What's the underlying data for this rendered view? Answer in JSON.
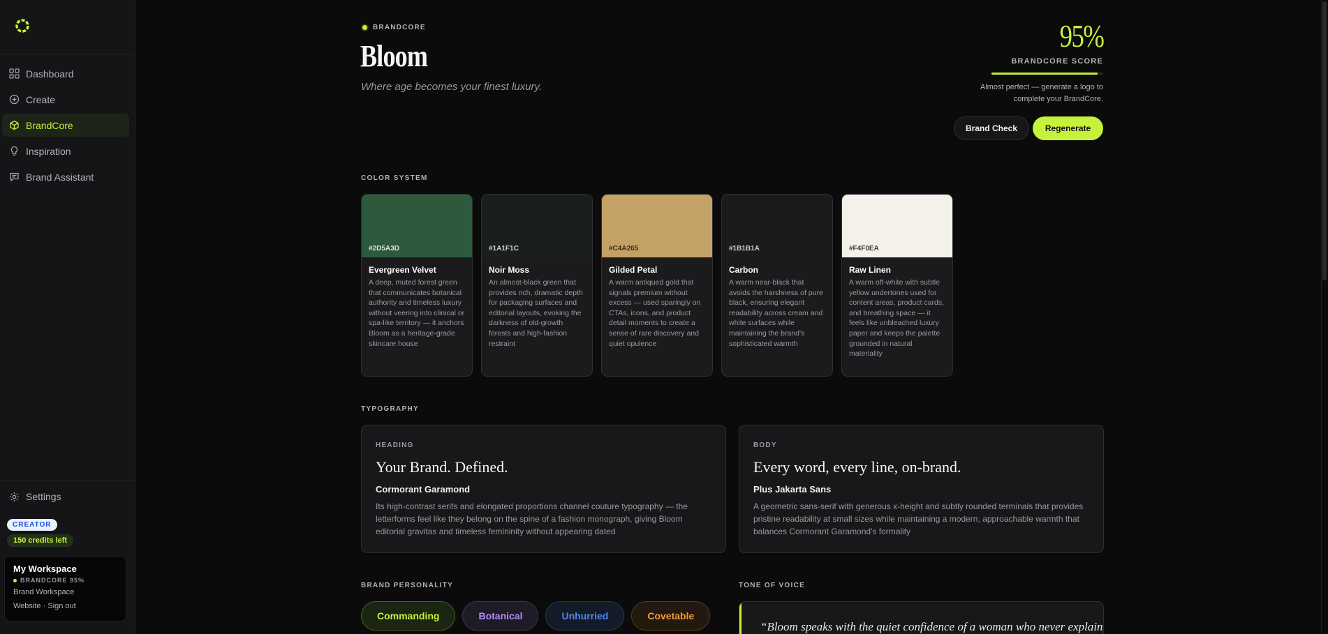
{
  "sidebar": {
    "nav": [
      {
        "label": "Dashboard",
        "icon": "grid-icon"
      },
      {
        "label": "Create",
        "icon": "plus-circle-icon"
      },
      {
        "label": "BrandCore",
        "icon": "cube-icon",
        "active": true
      },
      {
        "label": "Inspiration",
        "icon": "lightbulb-icon"
      },
      {
        "label": "Brand Assistant",
        "icon": "chat-icon"
      }
    ],
    "settings_label": "Settings",
    "plan_badge": "CREATOR",
    "credits": "150 credits left",
    "workspace": {
      "title": "My Workspace",
      "score": "BRANDCORE 95%",
      "type": "Brand Workspace",
      "link_website": "Website",
      "separator": " · ",
      "link_signout": "Sign out"
    }
  },
  "header": {
    "eyebrow": "BRANDCORE",
    "brand_name": "Bloom",
    "tagline": "Where age becomes your finest luxury."
  },
  "score": {
    "value": "95%",
    "fill_fraction": 0.95,
    "label": "BRANDCORE SCORE",
    "note": "Almost perfect — generate a logo to complete your BrandCore.",
    "brand_check_label": "Brand Check",
    "regenerate_label": "Regenerate"
  },
  "color_system": {
    "label": "COLOR SYSTEM",
    "swatches": [
      {
        "hex": "#2D5A3D",
        "name": "Evergreen Velvet",
        "hex_text_color": "#d9e4dc",
        "desc": "A deep, muted forest green that communicates botanical authority and timeless luxury without veering into clinical or spa-like territory — it anchors Bloom as a heritage-grade skincare house"
      },
      {
        "hex": "#1A1F1C",
        "name": "Noir Moss",
        "hex_text_color": "#d0d0d0",
        "desc": "An almost-black green that provides rich, dramatic depth for packaging surfaces and editorial layouts, evoking the darkness of old-growth forests and high-fashion restraint"
      },
      {
        "hex": "#C4A265",
        "name": "Gilded Petal",
        "hex_text_color": "#3a2f18",
        "desc": "A warm antiqued gold that signals premium without excess — used sparingly on CTAs, icons, and product detail moments to create a sense of rare discovery and quiet opulence"
      },
      {
        "hex": "#1B1B1A",
        "name": "Carbon",
        "hex_text_color": "#d0d0d0",
        "desc": "A warm near-black that avoids the harshness of pure black, ensuring elegant readability across cream and white surfaces while maintaining the brand's sophisticated warmth"
      },
      {
        "hex": "#F4F0EA",
        "name": "Raw Linen",
        "hex_text_color": "#3a3a3a",
        "desc": "A warm off-white with subtle yellow undertones used for content areas, product cards, and breathing space — it feels like unbleached luxury paper and keeps the palette grounded in natural materiality"
      }
    ]
  },
  "typography": {
    "label": "TYPOGRAPHY",
    "heading": {
      "kind": "HEADING",
      "sample": "Your Brand. Defined.",
      "font": "Cormorant Garamond",
      "desc": "Its high-contrast serifs and elongated proportions channel couture typography — the letterforms feel like they belong on the spine of a fashion monograph, giving Bloom editorial gravitas and timeless femininity without appearing dated"
    },
    "body": {
      "kind": "BODY",
      "sample": "Every word, every line, on-brand.",
      "font": "Plus Jakarta Sans",
      "desc": "A geometric sans-serif with generous x-height and subtly rounded terminals that provides pristine readability at small sizes while maintaining a modern, approachable warmth that balances Cormorant Garamond's formality"
    }
  },
  "personality": {
    "label": "BRAND PERSONALITY",
    "traits": [
      {
        "label": "Commanding",
        "color": "#c5f23a",
        "bg": "#1c2412",
        "border": "#4b5f1e"
      },
      {
        "label": "Botanical",
        "color": "#b18cf5",
        "bg": "#1e1a26",
        "border": "#3f3552"
      },
      {
        "label": "Unhurried",
        "color": "#4f86f7",
        "bg": "#141b28",
        "border": "#27375a"
      },
      {
        "label": "Covetable",
        "color": "#f29a3a",
        "bg": "#24190e",
        "border": "#5a3a1a"
      }
    ]
  },
  "tone": {
    "label": "TONE OF VOICE",
    "quote": "“Bloom speaks with the quiet confidence of a woman who never explains"
  },
  "accent": "#c5f23a"
}
